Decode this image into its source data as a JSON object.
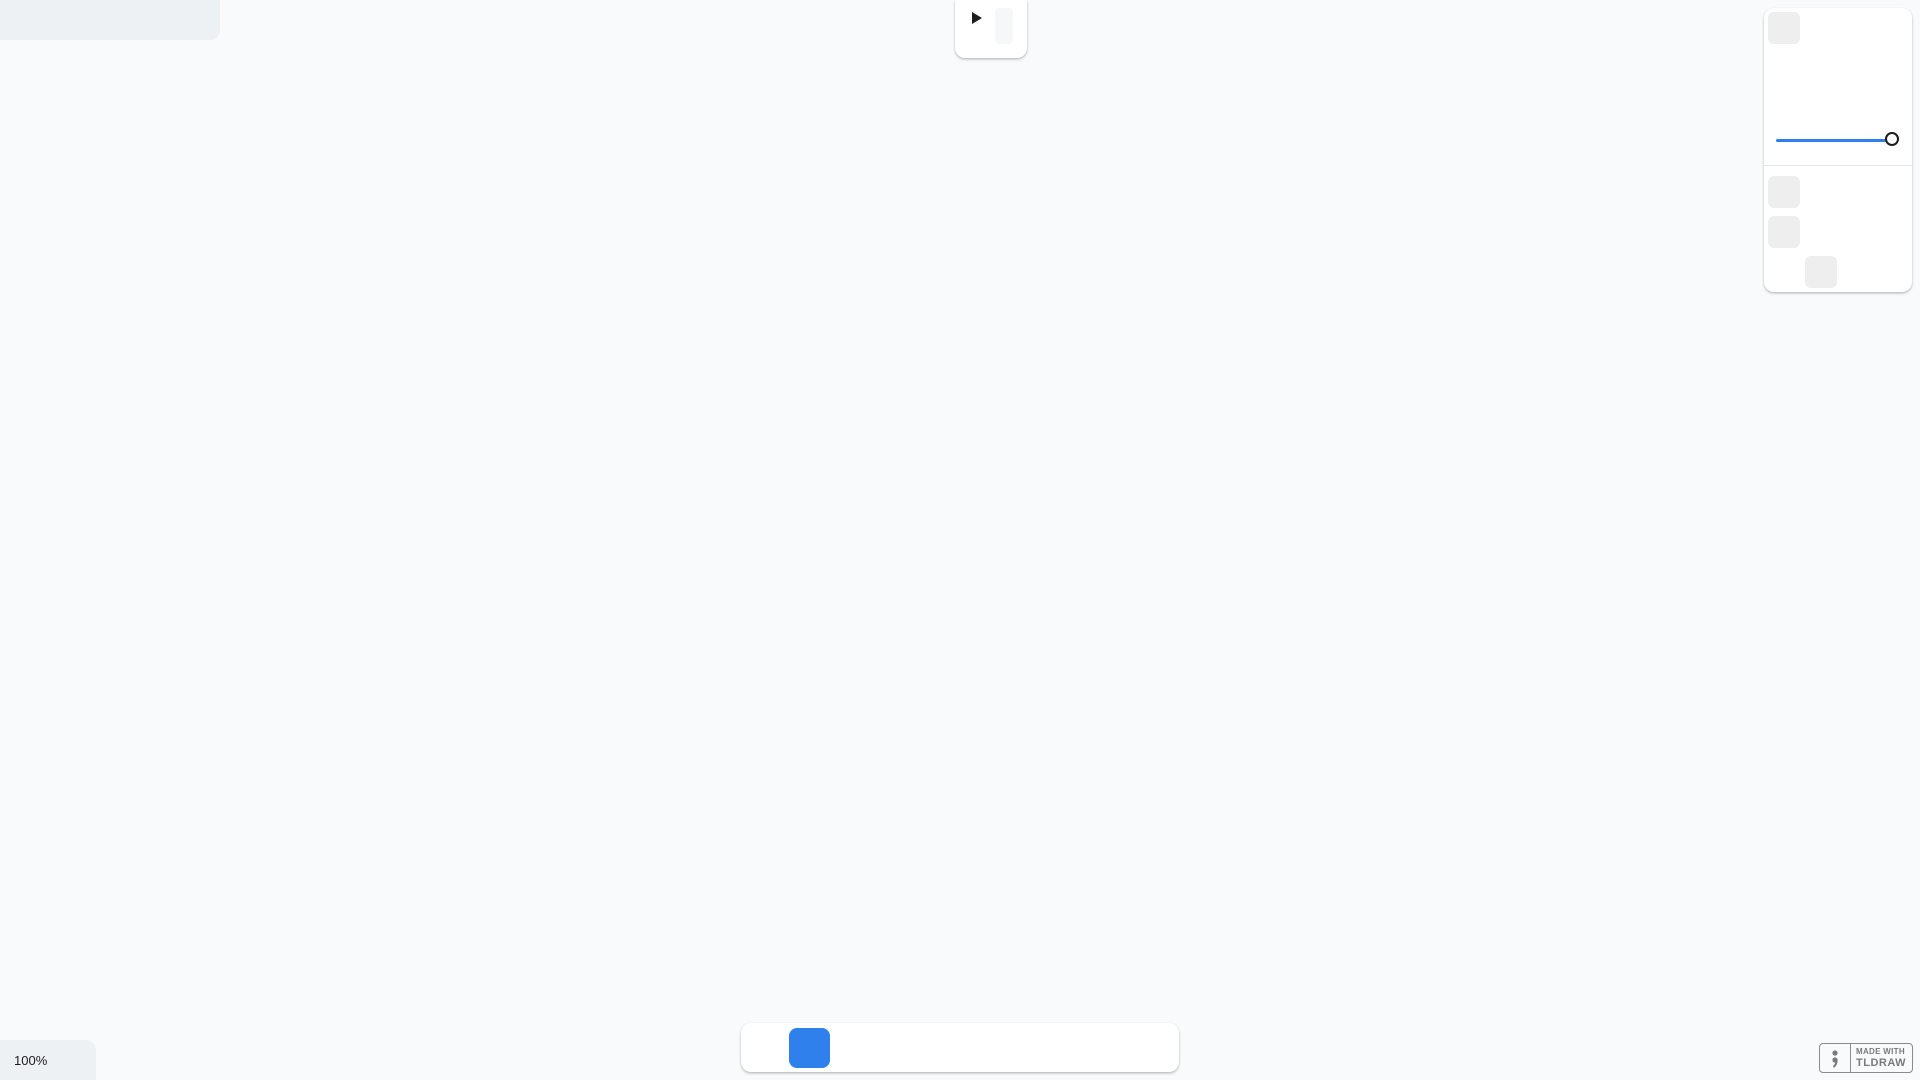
{
  "app": {
    "zoom_label": "100%"
  },
  "top_toolbar": {
    "play_icon": "play-icon"
  },
  "style_panel": {
    "opacity_slider_value": 1.0,
    "accent_color": "#2f80ed"
  },
  "bottom_toolbar": {
    "selected_tool_color": "#2f80ed"
  },
  "badge": {
    "line1": "MADE WITH",
    "line2": "TLDRAW"
  }
}
